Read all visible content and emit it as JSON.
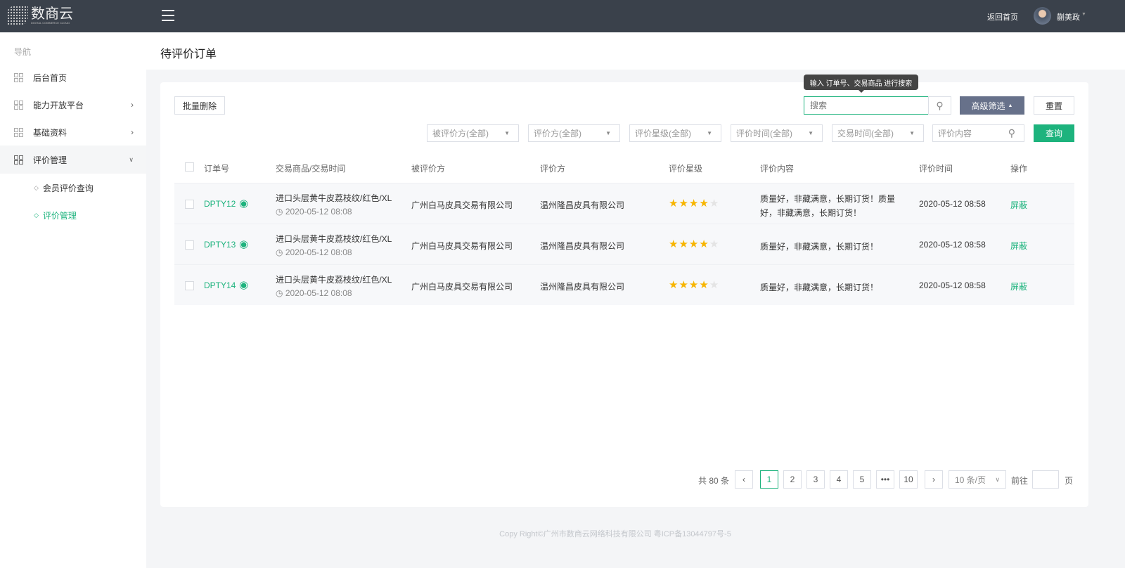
{
  "header": {
    "logo_text": "数商云",
    "logo_sub": "DIGITAL COMMERCE CLOUD",
    "back_home": "返回首页",
    "user_name": "蒯美政"
  },
  "sidebar": {
    "nav_label": "导航",
    "items": [
      {
        "label": "后台首页"
      },
      {
        "label": "能力开放平台"
      },
      {
        "label": "基础资料"
      },
      {
        "label": "评价管理"
      }
    ],
    "sub_items": [
      {
        "label": "会员评价查询"
      },
      {
        "label": "评价管理"
      }
    ]
  },
  "page": {
    "title": "待评价订单"
  },
  "toolbar": {
    "batch_delete": "批量删除",
    "search_placeholder": "搜索",
    "tooltip": "输入 订单号、交易商品 进行搜索",
    "advanced": "高级筛选",
    "reset": "重置"
  },
  "filters": {
    "selects": [
      "被评价方(全部)",
      "评价方(全部)",
      "评价星级(全部)",
      "评价时间(全部)",
      "交易时间(全部)"
    ],
    "content_placeholder": "评价内容",
    "query": "查询"
  },
  "table": {
    "headers": [
      "订单号",
      "交易商品/交易时间",
      "被评价方",
      "评价方",
      "评价星级",
      "评价内容",
      "评价时间",
      "操作"
    ],
    "rows": [
      {
        "order": "DPTY12",
        "goods": "进口头层黄牛皮荔枝纹/红色/XL",
        "trade_time": "2020-05-12 08:08",
        "rated": "广州白马皮具交易有限公司",
        "rater": "温州隆昌皮具有限公司",
        "stars": 4,
        "content": "质量好，非藏满意，长期订货！质量好，非藏满意，长期订货！",
        "time": "2020-05-12 08:58",
        "action": "屏蔽"
      },
      {
        "order": "DPTY13",
        "goods": "进口头层黄牛皮荔枝纹/红色/XL",
        "trade_time": "2020-05-12 08:08",
        "rated": "广州白马皮具交易有限公司",
        "rater": "温州隆昌皮具有限公司",
        "stars": 4,
        "content": "质量好，非藏满意，长期订货！",
        "time": "2020-05-12 08:58",
        "action": "屏蔽"
      },
      {
        "order": "DPTY14",
        "goods": "进口头层黄牛皮荔枝纹/红色/XL",
        "trade_time": "2020-05-12 08:08",
        "rated": "广州白马皮具交易有限公司",
        "rater": "温州隆昌皮具有限公司",
        "stars": 4,
        "content": "质量好，非藏满意，长期订货！",
        "time": "2020-05-12 08:58",
        "action": "屏蔽"
      }
    ]
  },
  "pagination": {
    "total": "共 80 条",
    "pages": [
      "1",
      "2",
      "3",
      "4",
      "5",
      "•••",
      "10"
    ],
    "current": "1",
    "page_size": "10 条/页",
    "goto": "前往",
    "page_unit": "页"
  },
  "footer": {
    "text": "Copy Right©广州市数商云网络科技有限公司 粤ICP备13044797号-5"
  }
}
